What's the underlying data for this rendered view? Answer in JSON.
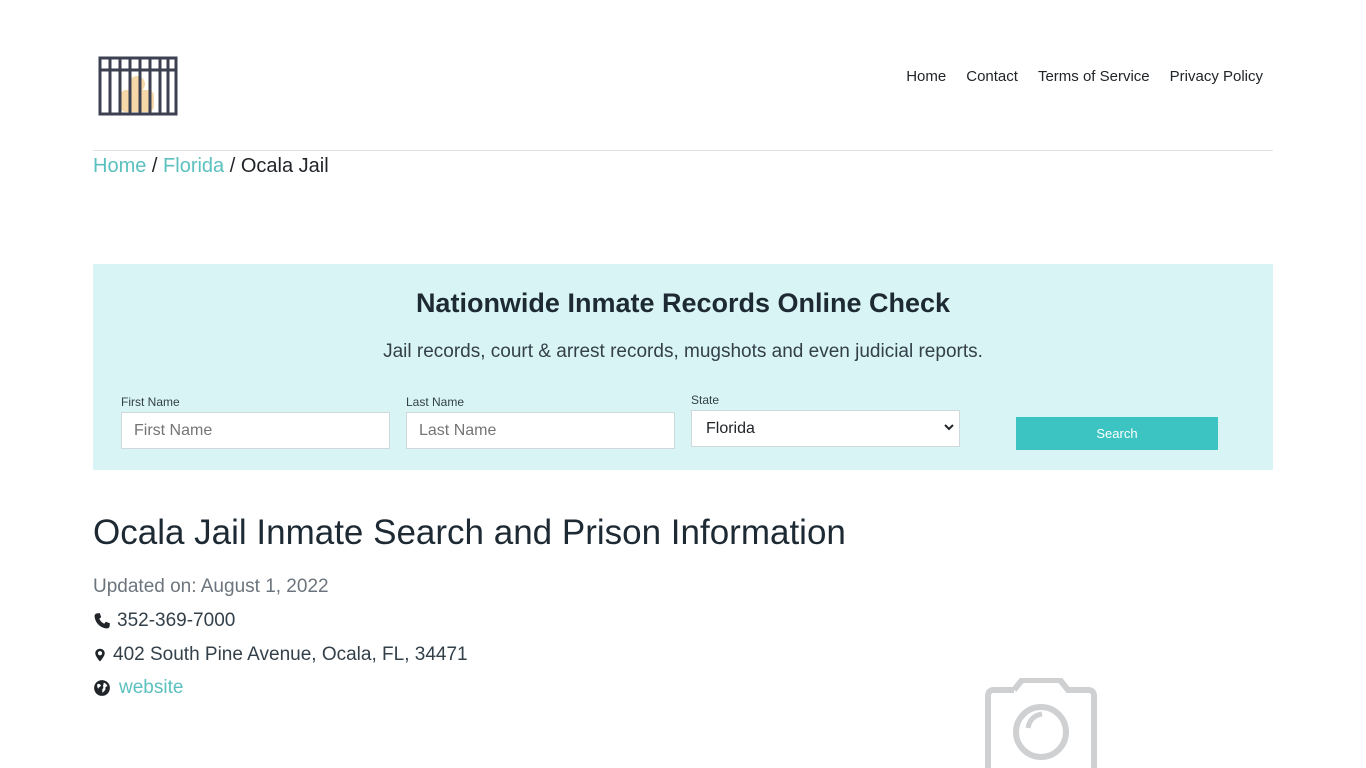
{
  "nav": {
    "items": [
      "Home",
      "Contact",
      "Terms of Service",
      "Privacy Policy"
    ]
  },
  "breadcrumb": {
    "home": "Home",
    "state": "Florida",
    "separator": "/",
    "current": "Ocala Jail"
  },
  "search": {
    "title": "Nationwide Inmate Records Online Check",
    "subtitle": "Jail records, court & arrest records, mugshots and even judicial reports.",
    "first_name_label": "First Name",
    "first_name_placeholder": "First Name",
    "last_name_label": "Last Name",
    "last_name_placeholder": "Last Name",
    "state_label": "State",
    "state_value": "Florida",
    "button_label": "Search"
  },
  "main": {
    "title": "Ocala Jail Inmate Search and Prison Information",
    "updated": "Updated on: August 1, 2022",
    "phone": "352-369-7000",
    "address": "402 South Pine Avenue, Ocala, FL, 34471",
    "website_label": "website"
  },
  "icons": {
    "logo": "jail-cell-icon",
    "phone": "phone-icon",
    "address": "map-marker-icon",
    "website": "globe-icon",
    "placeholder": "camera-icon"
  },
  "colors": {
    "accent": "#5bc0be",
    "button": "#3cc4c2",
    "panel": "#d9f4f4",
    "text": "#212529"
  }
}
